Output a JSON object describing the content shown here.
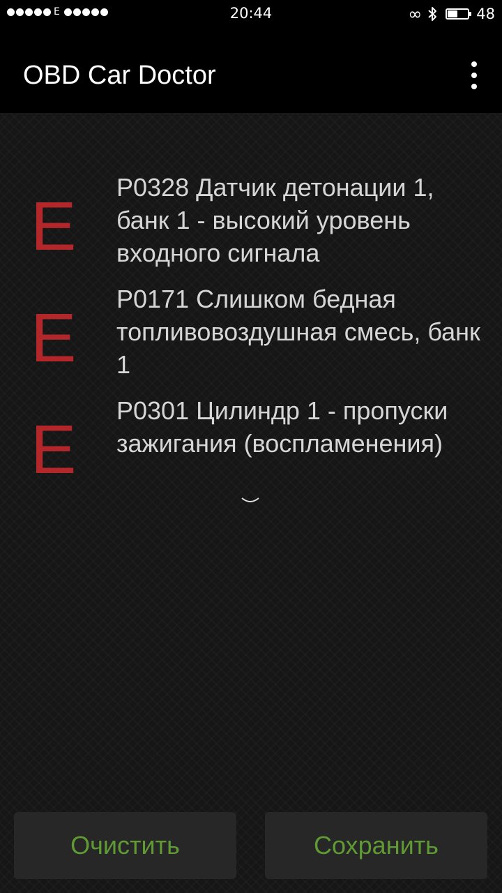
{
  "status_bar": {
    "network_type": "E",
    "time": "20:44",
    "battery_level": "48",
    "battery_fraction": 0.48,
    "icons": [
      "signal-dots",
      "infinity-icon",
      "bluetooth-icon",
      "battery-icon"
    ]
  },
  "app_bar": {
    "title": "OBD Car Doctor",
    "menu_icon": "overflow-menu-icon"
  },
  "trouble_codes": [
    {
      "severity": "E",
      "description": "P0328 Датчик детонации 1, банк 1 - высокий уровень входного сигнала"
    },
    {
      "severity": "E",
      "description": "P0171 Слишком бедная топливовоздушная смесь, банк 1"
    },
    {
      "severity": "E",
      "description": "P0301 Цилиндр 1 - пропуски зажигания (воспламенения)"
    }
  ],
  "buttons": {
    "clear_label": "Очистить",
    "save_label": "Сохранить"
  },
  "colors": {
    "severity_error": "#b3272b",
    "button_text": "#5f9a35",
    "button_bg": "#272727"
  }
}
